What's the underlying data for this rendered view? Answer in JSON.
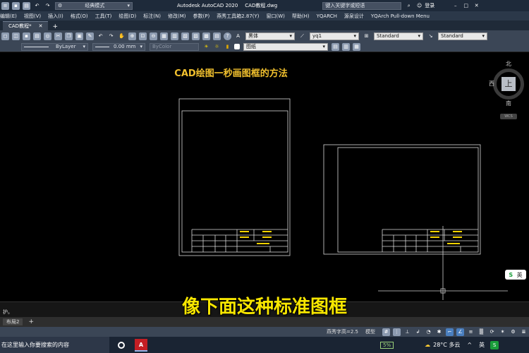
{
  "title_bar": {
    "workspace": "经典模式",
    "app_title": "Autodesk AutoCAD 2020",
    "file_name": "CAD教程.dwg",
    "search_placeholder": "键入关键字或短语",
    "login": "登录"
  },
  "menu": [
    "编辑(E)",
    "视图(V)",
    "插入(I)",
    "格式(O)",
    "工具(T)",
    "绘图(D)",
    "标注(N)",
    "修改(M)",
    "参数(P)",
    "燕秀工具箱2.87(Y)",
    "窗口(W)",
    "帮助(H)",
    "YQARCH",
    "源泉设计",
    "YQArch Pull-down Menu"
  ],
  "tabs": {
    "active": "CAD教程*",
    "add": "+"
  },
  "toolbar1": {
    "text_font": "黑体",
    "dim_style": "yq1",
    "text_style": "Standard",
    "table_style": "Standard"
  },
  "toolbar2": {
    "linetype": "ByLayer",
    "lineweight": "0.00 mm",
    "color": "ByColor",
    "layer": "图纸"
  },
  "drawing": {
    "heading": "CAD绘图一秒画图框的方法"
  },
  "viewcube": {
    "north": "北",
    "south": "南",
    "west": "西",
    "face": "上",
    "wcs": "WCS"
  },
  "command": {
    "text": "护。"
  },
  "layout": {
    "tab": "布局2",
    "add": "+"
  },
  "status": {
    "scale": "燕秀字高=2.5",
    "model": "模型"
  },
  "ime": {
    "label": "英"
  },
  "subtitle": "像下面这种标准图框",
  "taskbar": {
    "search": "在这里输入你要搜索的内容",
    "battery": "5%",
    "weather": "28°C 多云",
    "lang": "英"
  }
}
